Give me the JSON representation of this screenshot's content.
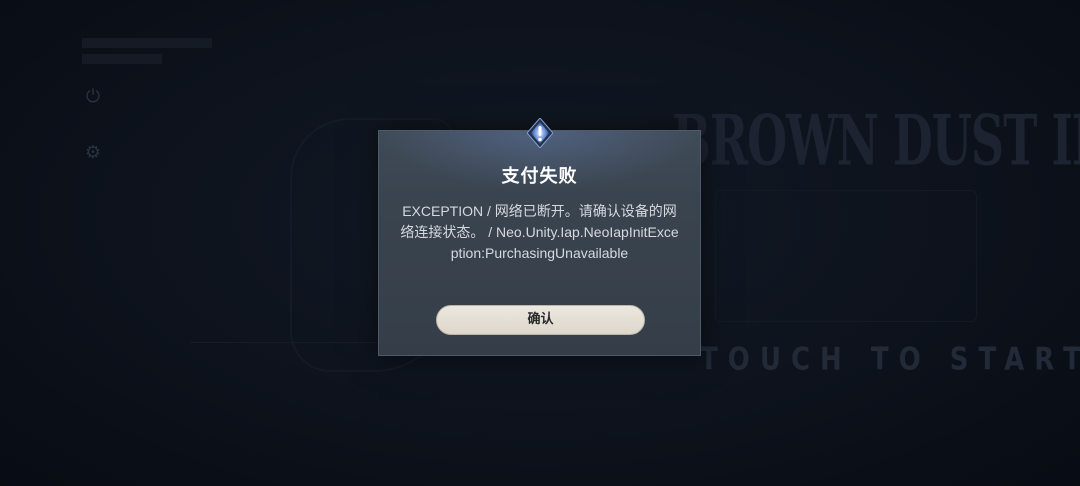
{
  "background": {
    "logo_text": "BROWN DUST II",
    "touch_text": "TOUCH TO START"
  },
  "dialog": {
    "title": "支付失败",
    "message": "EXCEPTION / 网络已断开。请确认设备的网络连接状态。 / Neo.Unity.Iap.NeoIapInitException:PurchasingUnavailable",
    "confirm_label": "确认",
    "emblem_icon": "diamond-emblem-icon"
  },
  "colors": {
    "background": "#0b1019",
    "dialog": "#3a444f",
    "button": "#e4dfd4",
    "emblem_glow": "#8fb4ff"
  }
}
